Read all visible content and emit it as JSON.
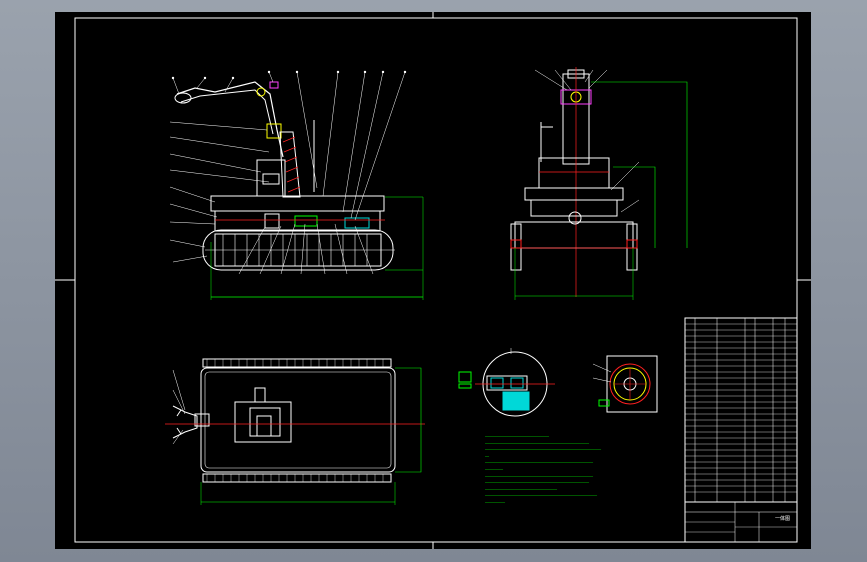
{
  "drawing": {
    "colors": {
      "background": "#000000",
      "frame": "#ffffff",
      "green": "#00ff00",
      "red": "#ff2020",
      "cyan": "#00d8d8",
      "yellow": "#ffff00",
      "magenta": "#ff40ff",
      "outer_bg": "#8c94a1"
    },
    "title_text": "一体图"
  }
}
